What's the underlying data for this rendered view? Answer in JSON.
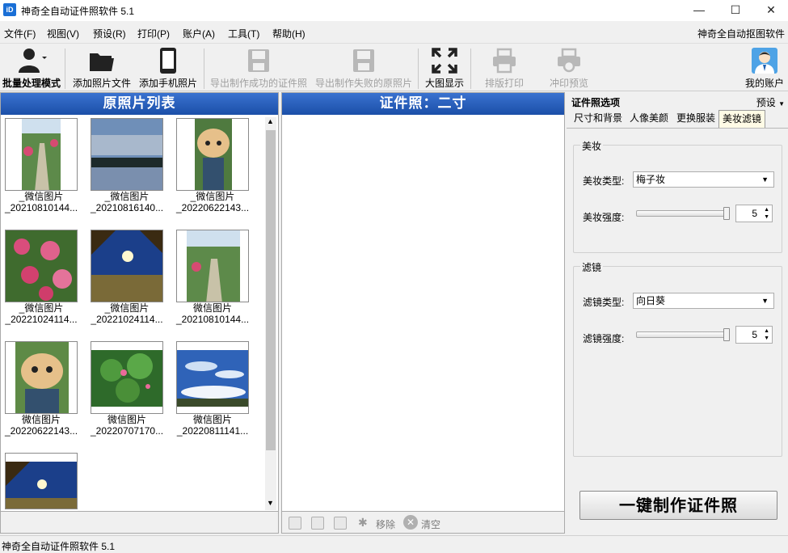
{
  "window": {
    "title": "神奇全自动证件照软件 5.1",
    "minimize": "—",
    "maximize": "☐",
    "close": "✕"
  },
  "menu": {
    "items": [
      "文件(F)",
      "视图(V)",
      "预设(R)",
      "打印(P)",
      "账户(A)",
      "工具(T)",
      "帮助(H)"
    ],
    "right_link": "神奇全自动抠图软件"
  },
  "toolbar": {
    "batch": "批量处理模式",
    "add_file": "添加照片文件",
    "add_phone": "添加手机照片",
    "export_ok": "导出制作成功的证件照",
    "export_fail": "导出制作失败的原照片",
    "large_view": "大图显示",
    "layout_print": "排版打印",
    "print_preview": "冲印预览",
    "account": "我的账户"
  },
  "photo_list": {
    "header": "原照片列表",
    "items": [
      {
        "line1": "_微信图片",
        "line2": "_20210810144..."
      },
      {
        "line1": "_微信图片",
        "line2": "_20210816140..."
      },
      {
        "line1": "_微信图片",
        "line2": "_20220622143..."
      },
      {
        "line1": "_微信图片",
        "line2": "_20221024114..."
      },
      {
        "line1": "_微信图片",
        "line2": "_20221024114..."
      },
      {
        "line1": "微信图片",
        "line2": "_20210810144..."
      },
      {
        "line1": "微信图片",
        "line2": "_20220622143..."
      },
      {
        "line1": "微信图片",
        "line2": "_20220707170..."
      },
      {
        "line1": "微信图片",
        "line2": "_20220811141..."
      }
    ]
  },
  "id_photo": {
    "header": "证件照：二寸",
    "remove": "移除",
    "clear": "清空"
  },
  "options": {
    "title": "证件照选项",
    "preset": "预设",
    "tabs": [
      "尺寸和背景",
      "人像美颜",
      "更换服装",
      "美妆滤镜"
    ],
    "makeup_group": "美妆",
    "makeup_type_label": "美妆类型:",
    "makeup_type_value": "梅子妆",
    "makeup_strength_label": "美妆强度:",
    "makeup_strength_value": "5",
    "makeup_strength_level": 1.0,
    "filter_group": "滤镜",
    "filter_type_label": "滤镜类型:",
    "filter_type_value": "向日葵",
    "filter_strength_label": "滤镜强度:",
    "filter_strength_value": "5",
    "filter_strength_level": 1.0,
    "make_button": "一键制作证件照"
  },
  "status": {
    "text": "神奇全自动证件照软件 5.1"
  }
}
